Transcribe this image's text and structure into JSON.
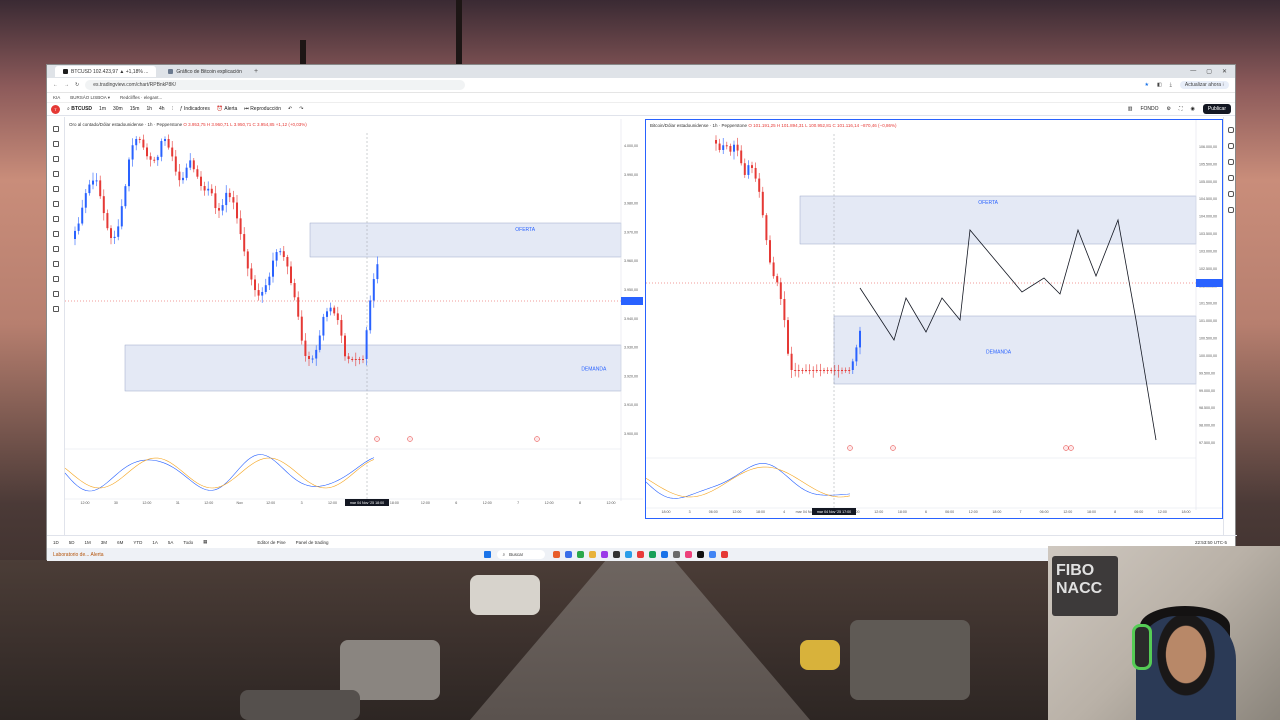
{
  "browser": {
    "tabs": [
      {
        "label": "BTCUSD 102.423,97 ▲ +1,18% ..."
      },
      {
        "label": "Gráfico de Bitcoin explicación"
      }
    ],
    "url": "es.tradingview.com/chart/RPBnkP8K/",
    "profile_label": "Actualizar ahora ⁝",
    "bookmarks": [
      "KIA",
      "BURSÁO LISBOA ▾",
      "Redcliffes · elegant..."
    ]
  },
  "tv_toolbar": {
    "symbol": "BTCUSD",
    "intervals": [
      "1m",
      "30m",
      "15m",
      "1h",
      "4h"
    ],
    "indicators_label": "Indicadores",
    "alert_label": "Alerta",
    "replay_label": "Reproducción",
    "layout_label": "FONDO",
    "publish_label": "Publicar"
  },
  "left_chart": {
    "title": "Oro al contado/Dólar estadounidense · 1h · Pepperstone",
    "ohlc": "O 3.953,75  H 3.960,71  L 3.950,71  C 3.954,85  +1,12 (+0,03%)",
    "zone_upper_label": "OFERTA",
    "zone_lower_label": "DEMANDA",
    "price_labels": [
      "4.000,00",
      "3.990,00",
      "3.980,00",
      "3.970,00",
      "3.960,00",
      "3.950,00",
      "3.940,00",
      "3.930,00",
      "3.920,00",
      "3.910,00",
      "3.900,00"
    ],
    "time_labels": [
      "12:00",
      "30",
      "12:00",
      "31",
      "12:00",
      "Nov",
      "12:00",
      "3",
      "12:00",
      "mar 04 Nov '25",
      "18:00",
      "12:00",
      "6",
      "12:00",
      "7",
      "12:00",
      "8",
      "12:00"
    ],
    "current_time_label": "mar 04 Nov '25  18:00"
  },
  "right_chart": {
    "title": "Bitcoin/Dólar estadounidense · 1h · Pepperstone",
    "ohlc": "O 101.191,25  H 101.894,31  L 100.952,81  C 101.116,14  −870,46 (−0,86%)",
    "zone_upper_label": "OFERTA",
    "zone_lower_label": "DEMANDA",
    "price_labels": [
      "106.000,00",
      "105.500,00",
      "105.000,00",
      "104.500,00",
      "104.000,00",
      "103.500,00",
      "103.000,00",
      "102.500,00",
      "102.000,00",
      "101.500,00",
      "101.000,00",
      "100.500,00",
      "100.000,00",
      "99.500,00",
      "99.000,00",
      "98.500,00",
      "98.000,00",
      "97.500,00"
    ],
    "time_labels": [
      "18:00",
      "3",
      "06:00",
      "12:00",
      "18:00",
      "4",
      "mar 04 Nov '25",
      "17:00",
      "06:00",
      "12:00",
      "18:00",
      "6",
      "06:00",
      "12:00",
      "18:00",
      "7",
      "06:00",
      "12:00",
      "18:00",
      "8",
      "06:00",
      "12:00",
      "18:00"
    ],
    "current_time_label": "mar 04 Nov '25  17:00"
  },
  "bottom_bar": {
    "ranges": [
      "1D",
      "5D",
      "1M",
      "3M",
      "6M",
      "YTD",
      "1A",
      "5A",
      "Todo"
    ],
    "tabs": [
      "Editor de Pine",
      "Panel de trading"
    ],
    "clock": "22:53:50 UTC-5"
  },
  "taskbar": {
    "search_placeholder": "Buscar",
    "left_app": "Laboratorio de... Alerta"
  },
  "webcam": {
    "sign_text": "FIBO NACC"
  },
  "colors": {
    "up": "#2962ff",
    "down": "#e53935",
    "zone_fill": "#dbe2f1",
    "projection": "#131722"
  }
}
